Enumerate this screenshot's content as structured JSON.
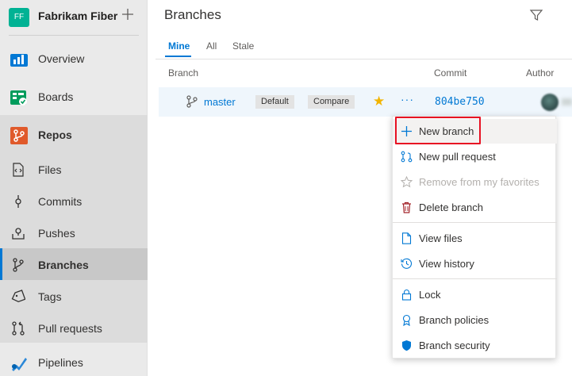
{
  "org": {
    "initials": "FF",
    "name": "Fabrikam Fiber"
  },
  "nav": [
    {
      "key": "overview",
      "label": "Overview"
    },
    {
      "key": "boards",
      "label": "Boards"
    },
    {
      "key": "repos",
      "label": "Repos"
    },
    {
      "key": "files",
      "label": "Files"
    },
    {
      "key": "commits",
      "label": "Commits"
    },
    {
      "key": "pushes",
      "label": "Pushes"
    },
    {
      "key": "branches",
      "label": "Branches"
    },
    {
      "key": "tags",
      "label": "Tags"
    },
    {
      "key": "pull_requests",
      "label": "Pull requests"
    },
    {
      "key": "pipelines",
      "label": "Pipelines"
    }
  ],
  "active_nav": "Branches",
  "page": {
    "title": "Branches"
  },
  "pivots": [
    {
      "label": "Mine"
    },
    {
      "label": "All"
    },
    {
      "label": "Stale"
    }
  ],
  "selected_pivot": "Mine",
  "columns": {
    "branch": "Branch",
    "commit": "Commit",
    "author": "Author"
  },
  "row": {
    "branch": "master",
    "default_tag": "Default",
    "compare_tag": "Compare",
    "more": "···",
    "commit": "804be750"
  },
  "menu": {
    "items": [
      {
        "label": "New branch",
        "icon": "plus-icon"
      },
      {
        "label": "New pull request",
        "icon": "pull-request-icon"
      },
      {
        "label": "Remove from my favorites",
        "icon": "star-outline-icon",
        "disabled": true
      },
      {
        "label": "Delete branch",
        "icon": "trash-icon"
      },
      {
        "label": "View files",
        "icon": "file-icon"
      },
      {
        "label": "View history",
        "icon": "history-icon"
      },
      {
        "label": "Lock",
        "icon": "lock-icon"
      },
      {
        "label": "Branch policies",
        "icon": "policy-icon"
      },
      {
        "label": "Branch security",
        "icon": "shield-icon"
      }
    ]
  },
  "colors": {
    "accent": "#0078d4",
    "org_avatar": "#00b294",
    "favorite_star": "#f2b400",
    "callout": "#e81123",
    "delete_icon": "#a4262c"
  }
}
